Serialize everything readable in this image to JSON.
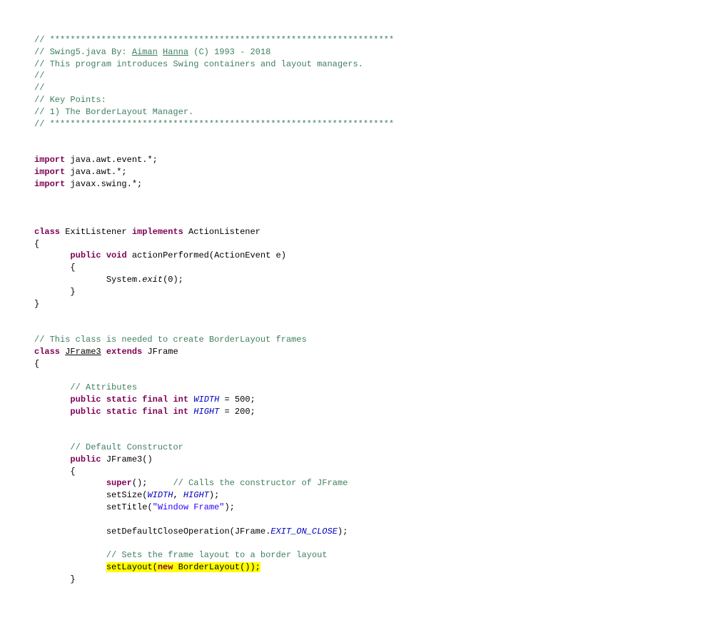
{
  "lines": {
    "l1": "// *******************************************************************",
    "l2a": "// Swing5.java By: ",
    "l2b": "Aiman",
    "l2c": " ",
    "l2d": "Hanna",
    "l2e": " (C) 1993 - 2018",
    "l3": "// This program introduces Swing containers and layout managers.",
    "l4": "//",
    "l5": "//",
    "l6": "// Key Points:",
    "l7": "// 1) The BorderLayout Manager.",
    "l8": "// *******************************************************************",
    "imp": "import",
    "imp1": " java.awt.event.*;",
    "imp2": " java.awt.*;",
    "imp3": " javax.swing.*;",
    "class": "class",
    "implements": "implements",
    "exitlis": " ExitListener ",
    "actionlis": " ActionListener",
    "lbrace": "{",
    "rbrace": "}",
    "tab1": "       ",
    "tab2": "              ",
    "public": "public",
    "void": "void",
    "actperf": " actionPerformed(ActionEvent e)",
    "sysexit1": "System.",
    "sysexit2": "exit",
    "sysexit3": "(0);",
    "comment_needed": "// This class is needed to create BorderLayout frames",
    "jframe3u": "JFrame3",
    "extends": "extends",
    "jframe": " JFrame",
    "attr_c": "// Attributes",
    "static": "static",
    "final": "final",
    "int": "int",
    "width_i": "WIDTH",
    "eq500": " = 500;",
    "hight_i": "HIGHT",
    "eq200": " = 200;",
    "defcon_c": "// Default Constructor",
    "jframe3c": " JFrame3()",
    "super": "super",
    "super_after": "();     ",
    "super_c": "// Calls the constructor of JFrame",
    "setsize1": "setSize(",
    "comma": ", ",
    "setsize3": ");",
    "settitle1": "setTitle(",
    "settitle2": "\"Window Frame\"",
    "settitle3": ");",
    "setdef1": "setDefaultCloseOperation(JFrame.",
    "setdef2": "EXIT_ON_CLOSE",
    "setdef3": ");",
    "setlay_c": "// Sets the frame layout to a border layout",
    "setlay1": "setLayout(",
    "new": "new",
    "setlay2": " BorderLayout());"
  }
}
